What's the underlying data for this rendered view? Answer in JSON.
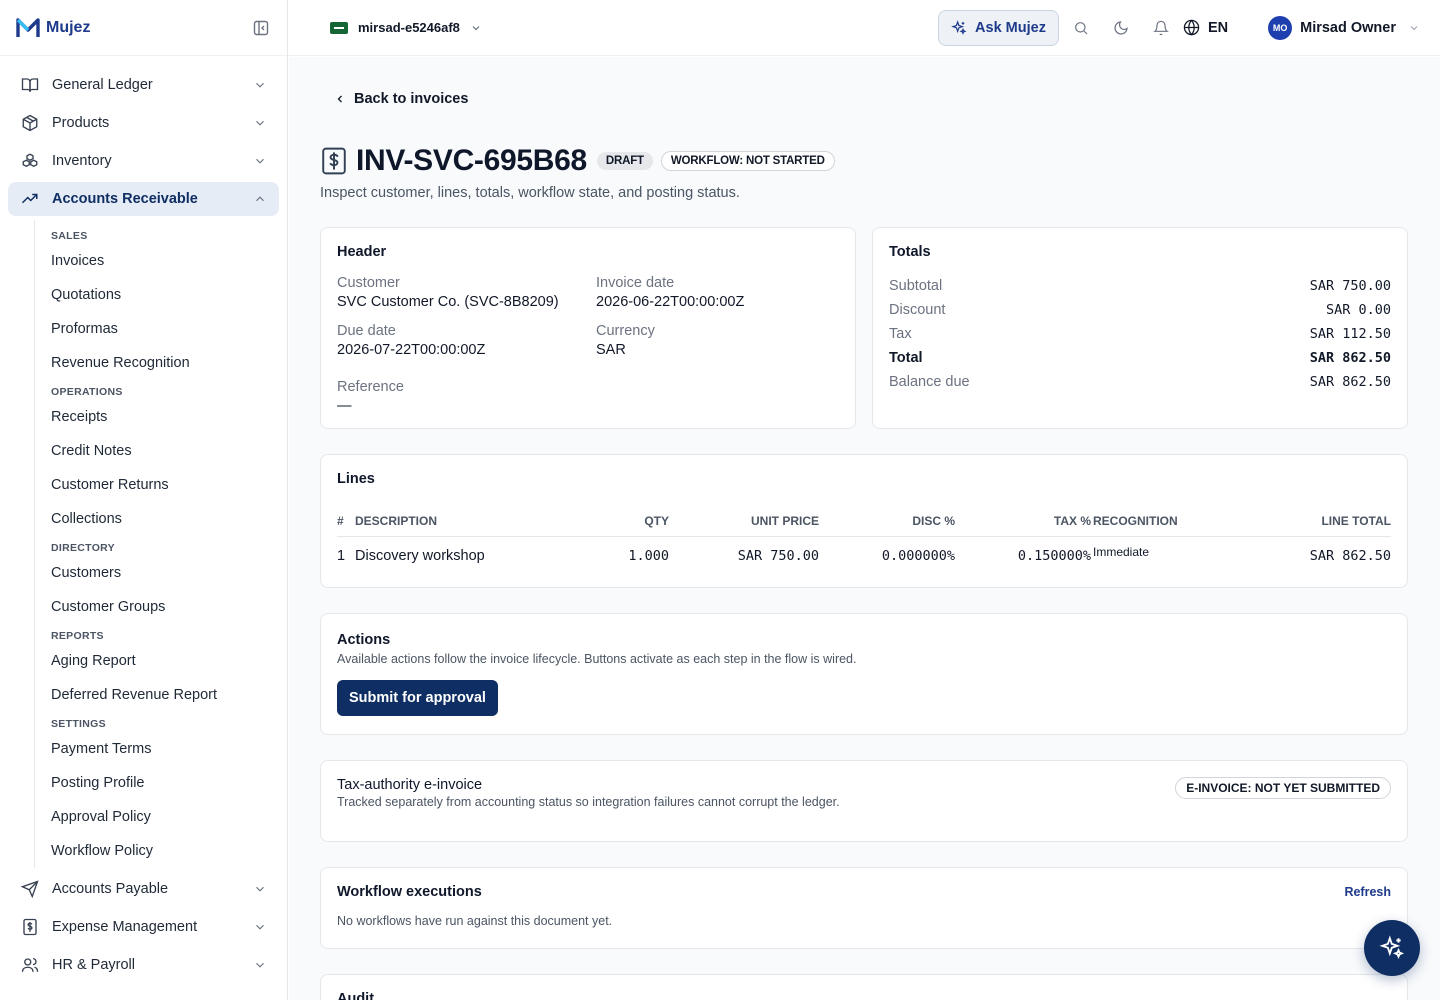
{
  "brand": {
    "name": "Mujez"
  },
  "sidebar": {
    "items_top": [
      {
        "label": "General Ledger",
        "icon": "book-open-icon"
      },
      {
        "label": "Products",
        "icon": "box-icon"
      },
      {
        "label": "Inventory",
        "icon": "boxes-icon"
      }
    ],
    "active": {
      "label": "Accounts Receivable",
      "icon": "trending-up-icon"
    },
    "sections": [
      {
        "title": "SALES",
        "items": [
          "Invoices",
          "Quotations",
          "Proformas",
          "Revenue Recognition"
        ]
      },
      {
        "title": "OPERATIONS",
        "items": [
          "Receipts",
          "Credit Notes",
          "Customer Returns",
          "Collections"
        ]
      },
      {
        "title": "DIRECTORY",
        "items": [
          "Customers",
          "Customer Groups"
        ]
      },
      {
        "title": "REPORTS",
        "items": [
          "Aging Report",
          "Deferred Revenue Report"
        ]
      },
      {
        "title": "SETTINGS",
        "items": [
          "Payment Terms",
          "Posting Profile",
          "Approval Policy",
          "Workflow Policy"
        ]
      }
    ],
    "items_bottom": [
      {
        "label": "Accounts Payable",
        "icon": "send-icon"
      },
      {
        "label": "Expense Management",
        "icon": "receipt-icon"
      },
      {
        "label": "HR & Payroll",
        "icon": "users-icon"
      }
    ]
  },
  "topbar": {
    "tenant": "mirsad-e5246af8",
    "ask_label": "Ask Mujez",
    "lang": "EN",
    "user_initials": "MO",
    "user_name": "Mirsad Owner"
  },
  "page": {
    "back_label": "Back to invoices",
    "title": "INV-SVC-695B68",
    "badge_status": "DRAFT",
    "badge_workflow": "WORKFLOW: NOT STARTED",
    "subtitle": "Inspect customer, lines, totals, workflow state, and posting status."
  },
  "header_card": {
    "title": "Header",
    "customer_label": "Customer",
    "customer_value": "SVC Customer Co. (SVC-8B8209)",
    "invoice_date_label": "Invoice date",
    "invoice_date_value": "2026-06-22T00:00:00Z",
    "due_date_label": "Due date",
    "due_date_value": "2026-07-22T00:00:00Z",
    "currency_label": "Currency",
    "currency_value": "SAR",
    "reference_label": "Reference",
    "reference_value": "—"
  },
  "totals_card": {
    "title": "Totals",
    "rows": [
      {
        "label": "Subtotal",
        "value": "SAR 750.00"
      },
      {
        "label": "Discount",
        "value": "SAR 0.00"
      },
      {
        "label": "Tax",
        "value": "SAR 112.50"
      },
      {
        "label": "Total",
        "value": "SAR 862.50"
      },
      {
        "label": "Balance due",
        "value": "SAR 862.50"
      }
    ]
  },
  "lines_card": {
    "title": "Lines",
    "headers": {
      "num": "#",
      "desc": "DESCRIPTION",
      "qty": "QTY",
      "unit": "UNIT PRICE",
      "disc": "DISC %",
      "tax": "TAX %",
      "rec": "RECOGNITION",
      "total": "LINE TOTAL"
    },
    "rows": [
      {
        "num": "1",
        "desc": "Discovery workshop",
        "qty": "1.000",
        "unit": "SAR 750.00",
        "disc": "0.000000%",
        "tax": "0.150000%",
        "rec": "Immediate",
        "total": "SAR 862.50"
      }
    ]
  },
  "actions_card": {
    "title": "Actions",
    "helper": "Available actions follow the invoice lifecycle. Buttons activate as each step in the flow is wired.",
    "submit_label": "Submit for approval"
  },
  "einvoice_card": {
    "title": "Tax-authority e-invoice",
    "helper": "Tracked separately from accounting status so integration failures cannot corrupt the ledger.",
    "badge": "E-INVOICE: NOT YET SUBMITTED"
  },
  "workflow_card": {
    "title": "Workflow executions",
    "refresh_label": "Refresh",
    "empty": "No workflows have run against this document yet."
  },
  "audit_card": {
    "title": "Audit"
  },
  "colors": {
    "primary": "#0f2e63",
    "accent": "#1e3a8a",
    "active_bg": "#e6ecf6"
  }
}
